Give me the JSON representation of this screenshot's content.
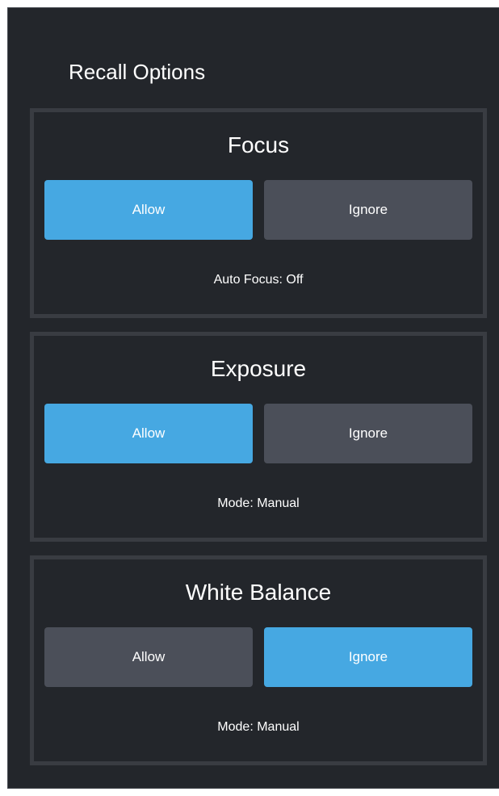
{
  "panel": {
    "title": "Recall Options"
  },
  "sections": [
    {
      "title": "Focus",
      "allow_label": "Allow",
      "ignore_label": "Ignore",
      "selected": "Allow",
      "status": "Auto Focus: Off"
    },
    {
      "title": "Exposure",
      "allow_label": "Allow",
      "ignore_label": "Ignore",
      "selected": "Allow",
      "status": "Mode: Manual"
    },
    {
      "title": "White Balance",
      "allow_label": "Allow",
      "ignore_label": "Ignore",
      "selected": "Ignore",
      "status": "Mode: Manual"
    }
  ],
  "colors": {
    "panel_bg": "#23262b",
    "section_border": "#393c42",
    "active_button": "#46a8e2",
    "inactive_button": "#4b4f59",
    "text": "#ffffff"
  }
}
